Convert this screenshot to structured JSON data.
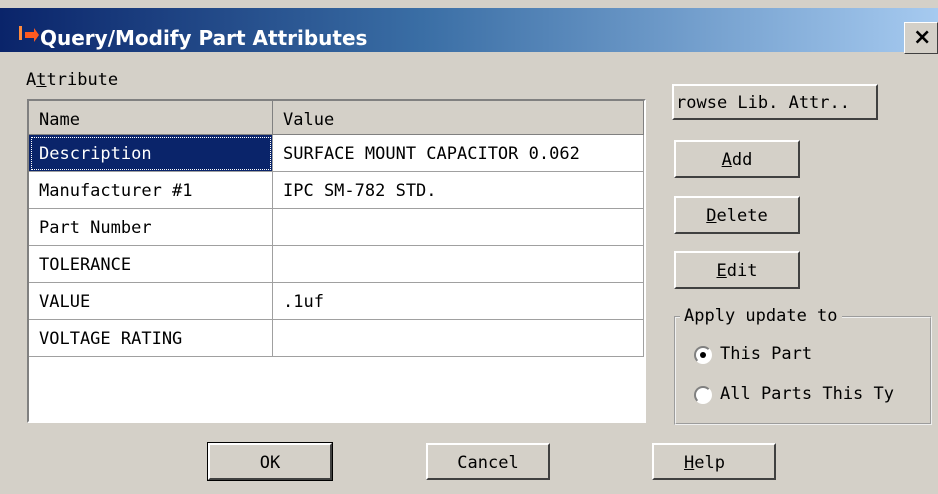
{
  "window": {
    "title": "Query/Modify Part Attributes",
    "close_glyph": "×"
  },
  "attribute_group": {
    "label": "Attribute"
  },
  "table": {
    "headers": [
      "Name",
      "Value"
    ],
    "rows": [
      {
        "name": "Description",
        "value": "SURFACE MOUNT CAPACITOR 0.062",
        "selected": true
      },
      {
        "name": "Manufacturer #1",
        "value": "IPC SM-782 STD.",
        "selected": false
      },
      {
        "name": "Part Number",
        "value": "",
        "selected": false
      },
      {
        "name": "TOLERANCE",
        "value": "",
        "selected": false
      },
      {
        "name": "VALUE",
        "value": ".1uf",
        "selected": false
      },
      {
        "name": "VOLTAGE RATING",
        "value": "",
        "selected": false
      }
    ]
  },
  "side_buttons": {
    "browse": "rowse Lib. Attr..",
    "add": "Add",
    "delete": "Delete",
    "edit": "Edit"
  },
  "apply_update": {
    "legend": "Apply update to",
    "options": [
      "This Part",
      "All Parts This Ty"
    ],
    "selected": "This Part"
  },
  "footer_buttons": {
    "ok": "OK",
    "cancel": "Cancel",
    "help": "Help"
  },
  "colors": {
    "title_start": "#0a246a",
    "title_end": "#a6caf0",
    "dialog_face": "#d4d0c8",
    "selection": "#0a246a"
  }
}
